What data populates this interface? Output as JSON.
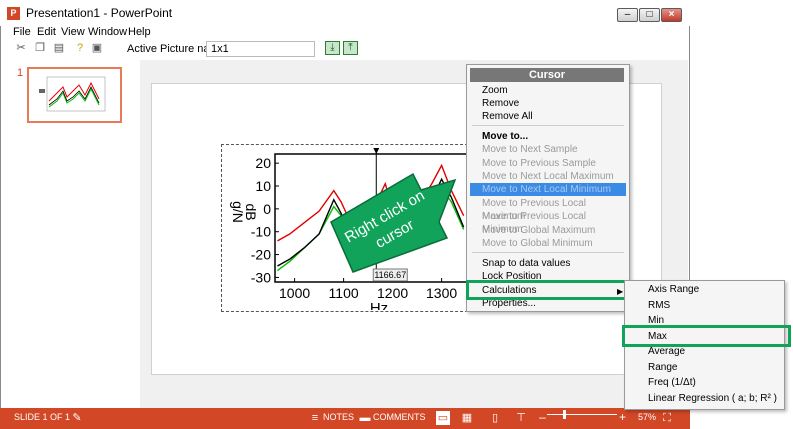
{
  "window": {
    "title": "Presentation1 - PowerPoint",
    "app_icon": "P"
  },
  "titlebar_buttons": {
    "minimize": "–",
    "maximize": "□",
    "close": "×"
  },
  "menubar": [
    "File",
    "Edit",
    "View",
    "Window",
    "Help"
  ],
  "toolbar": {
    "icons": [
      "cut-icon",
      "copy-icon",
      "paste-icon",
      "help-icon",
      "properties-icon"
    ],
    "active_picture_label": "Active Picture name:",
    "active_picture_value": "1x1"
  },
  "thumbnails": {
    "slide_number": "1"
  },
  "chart_data": {
    "type": "line",
    "xlabel": "Hz",
    "ylabel": "g/N\ndB",
    "xticks": [
      "1000",
      "1100",
      "1200",
      "1300"
    ],
    "yticks": [
      "20",
      "10",
      "0",
      "-10",
      "-20",
      "-30"
    ],
    "xlim": [
      960,
      1360
    ],
    "ylim": [
      -32,
      24
    ],
    "cursor_label": "1166.67",
    "cursor_x": 1166.67,
    "series": [
      {
        "color": "#e00000",
        "x": [
          965,
          990,
          1020,
          1050,
          1080,
          1095,
          1110,
          1140,
          1165,
          1185,
          1200,
          1220,
          1250,
          1280,
          1300,
          1320,
          1345
        ],
        "y": [
          -14,
          -11,
          -6,
          -1,
          8,
          3,
          -4,
          -6,
          2,
          11,
          0,
          -4,
          1,
          11,
          19,
          8,
          -3
        ]
      },
      {
        "color": "#00c000",
        "x": [
          965,
          990,
          1020,
          1050,
          1080,
          1095,
          1110,
          1140,
          1165,
          1185,
          1200,
          1220,
          1250,
          1280,
          1300,
          1320,
          1345
        ],
        "y": [
          -27,
          -23,
          -17,
          -11,
          1,
          -3,
          -13,
          -17,
          -10,
          3,
          -7,
          -12,
          -8,
          1,
          9,
          3,
          -9
        ]
      },
      {
        "color": "#000000",
        "x": [
          965,
          990,
          1020,
          1050,
          1080,
          1095,
          1110,
          1140,
          1165,
          1185,
          1200,
          1220,
          1250,
          1280,
          1300,
          1320,
          1345
        ],
        "y": [
          -25,
          -22,
          -17,
          -11,
          4,
          -2,
          -13,
          -17,
          -9,
          6,
          -6,
          -11,
          -8,
          4,
          13,
          5,
          -8
        ]
      }
    ]
  },
  "callout": {
    "line1": "Right click on",
    "line2": "cursor",
    "color": "#12a35a"
  },
  "cursor_menu": {
    "header": "Cursor",
    "items": [
      {
        "label": "Zoom",
        "state": "normal"
      },
      {
        "label": "Remove",
        "state": "normal"
      },
      {
        "label": "Remove All",
        "state": "normal"
      },
      {
        "label": "Move to...",
        "state": "bold"
      },
      {
        "label": "Move to Next Sample",
        "state": "disabled"
      },
      {
        "label": "Move to Previous Sample",
        "state": "disabled"
      },
      {
        "label": "Move to Next Local Maximum",
        "state": "disabled"
      },
      {
        "label": "Move to Next Local Minimum",
        "state": "hilite"
      },
      {
        "label": "Move to Previous Local Maximum",
        "state": "disabled"
      },
      {
        "label": "Move to Previous Local Minimum",
        "state": "disabled"
      },
      {
        "label": "Move to Global Maximum",
        "state": "disabled"
      },
      {
        "label": "Move to Global Minimum",
        "state": "disabled"
      },
      {
        "label": "Snap to data values",
        "state": "normal"
      },
      {
        "label": "Lock Position",
        "state": "normal"
      },
      {
        "label": "Calculations",
        "state": "normal"
      },
      {
        "label": "Properties...",
        "state": "normal"
      }
    ]
  },
  "submenu": {
    "items": [
      "Axis Range",
      "RMS",
      "Min",
      "Max",
      "Average",
      "Range",
      "Freq (1/Δt)",
      "Linear Regression ( a; b; R² )"
    ]
  },
  "statusbar": {
    "slide_info": "SLIDE 1 OF 1",
    "notes": "NOTES",
    "comments": "COMMENTS",
    "zoom_minus": "–",
    "zoom_plus": "+",
    "zoom_level": "57%"
  },
  "colors": {
    "accent": "#d24726",
    "highlight_box": "#12a35a",
    "menu_highlight": "#3b8be5"
  }
}
